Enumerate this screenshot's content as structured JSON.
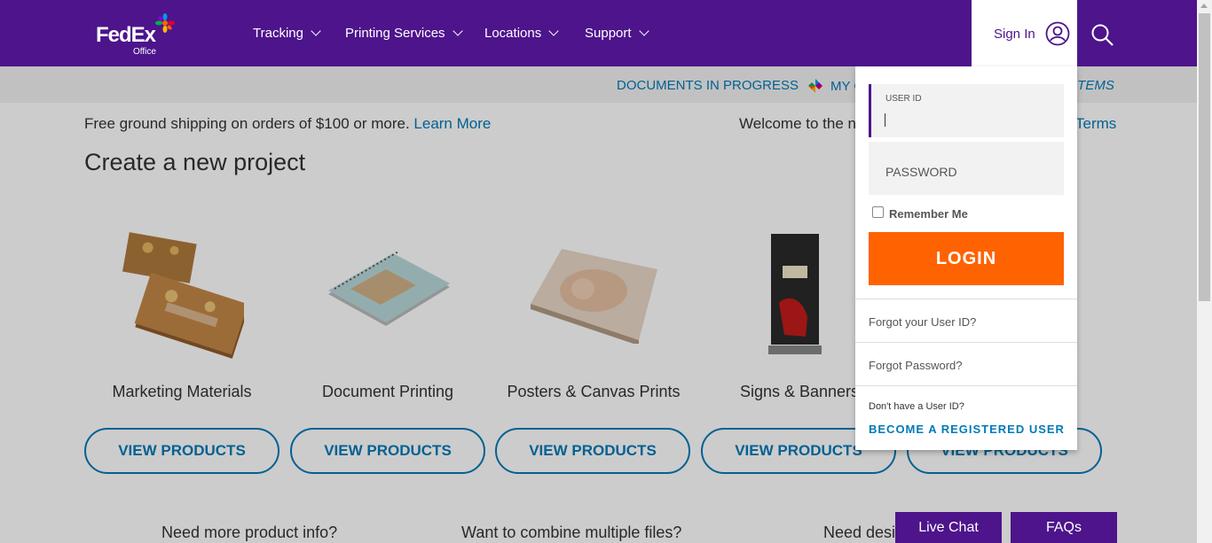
{
  "header": {
    "logo_fed": "Fed",
    "logo_ex": "Ex",
    "logo_sub": "Office",
    "nav": [
      "Tracking",
      "Printing Services",
      "Locations",
      "Support"
    ],
    "sign_in": "Sign In"
  },
  "subnav": {
    "documents": "DOCUMENTS IN PROGRESS",
    "my_c": "MY C",
    "items": "ITEMS"
  },
  "promo": {
    "text": "Free ground shipping on orders of $100 or more.",
    "link": "Learn More",
    "welcome": "Welcome to the n",
    "terms": "Terms"
  },
  "main": {
    "heading": "Create a new project",
    "products": [
      {
        "label": "Marketing Materials",
        "button": "VIEW PRODUCTS"
      },
      {
        "label": "Document Printing",
        "button": "VIEW PRODUCTS"
      },
      {
        "label": "Posters & Canvas Prints",
        "button": "VIEW PRODUCTS"
      },
      {
        "label": "Signs & Banners",
        "button": "VIEW PRODUCTS"
      },
      {
        "label": "",
        "button": "VIEW PRODUCTS"
      }
    ],
    "info": [
      "Need more product info?",
      "Want to combine multiple files?",
      "Need desig"
    ]
  },
  "login": {
    "user_id_label": "USER ID",
    "password_label": "PASSWORD",
    "remember": "Remember Me",
    "login_button": "LOGIN",
    "forgot_user": "Forgot your User ID?",
    "forgot_password": "Forgot Password?",
    "no_id": "Don't have a User ID?",
    "register": "BECOME A REGISTERED USER"
  },
  "footer": {
    "chat": "Live Chat",
    "faq": "FAQs"
  },
  "colors": {
    "brand_purple": "#4d148c",
    "brand_orange": "#ff6200",
    "link_blue": "#007ab7"
  },
  "icons": [
    "user-icon",
    "search-icon",
    "chevron-down-icon",
    "pinwheel-icon",
    "fedex-burst-icon"
  ]
}
